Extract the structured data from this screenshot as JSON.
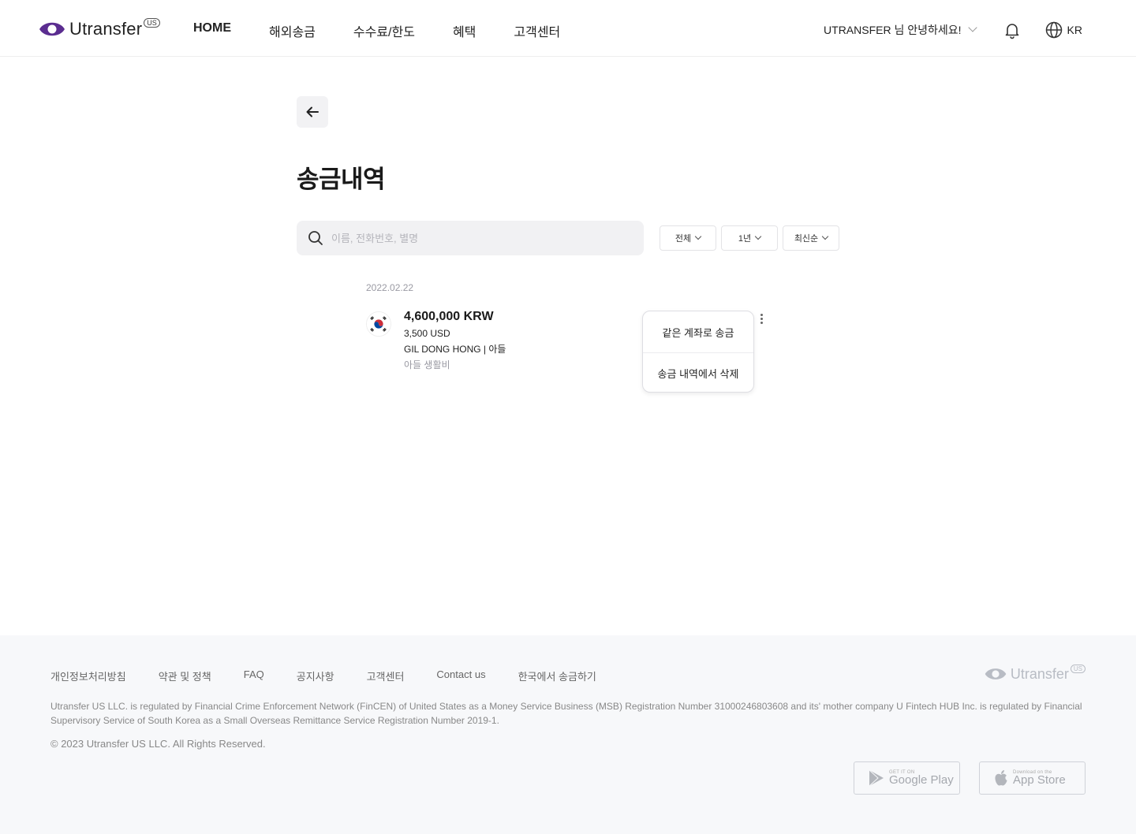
{
  "header": {
    "logo_text": "Utransfer",
    "logo_badge": "US",
    "nav": [
      "HOME",
      "해외송금",
      "수수료/한도",
      "혜택",
      "고객센터"
    ],
    "greeting": "UTRANSFER 님 안녕하세요!",
    "language": "KR"
  },
  "page": {
    "title": "송금내역",
    "search_placeholder": "이름, 전화번호, 별명",
    "filters": {
      "type": "전체",
      "period": "1년",
      "sort": "최신순"
    }
  },
  "transactions": [
    {
      "date": "2022.02.22",
      "amount": "4,600,000 KRW",
      "usd": "3,500 USD",
      "recipient": "GIL DONG HONG | 아들",
      "memo": "아들 생활비"
    }
  ],
  "context_menu": {
    "resend": "같은 계좌로 송금",
    "delete": "송금 내역에서 삭제"
  },
  "footer": {
    "links": [
      "개인정보처리방침",
      "약관 및 정책",
      "FAQ",
      "공지사항",
      "고객센터",
      "Contact us",
      "한국에서 송금하기"
    ],
    "logo_text": "Utransfer",
    "logo_badge": "US",
    "legal": "Utransfer US LLC. is regulated by Financial Crime Enforcement Network (FinCEN) of United States as a Money Service Business (MSB) Registration Number 31000246803608 and its' mother company U Fintech HUB Inc. is regulated by Financial Supervisory Service of South Korea as a Small Overseas Remittance Service Registration Number 2019-1.",
    "copyright": "© 2023 Utransfer US LLC. All Rights Reserved.",
    "google_play_small": "GET IT ON",
    "google_play_big": "Google Play",
    "app_store_small": "Download on the",
    "app_store_big": "App Store"
  },
  "colors": {
    "brand": "#5b2d90",
    "footer_bg": "#f7f8fa"
  }
}
